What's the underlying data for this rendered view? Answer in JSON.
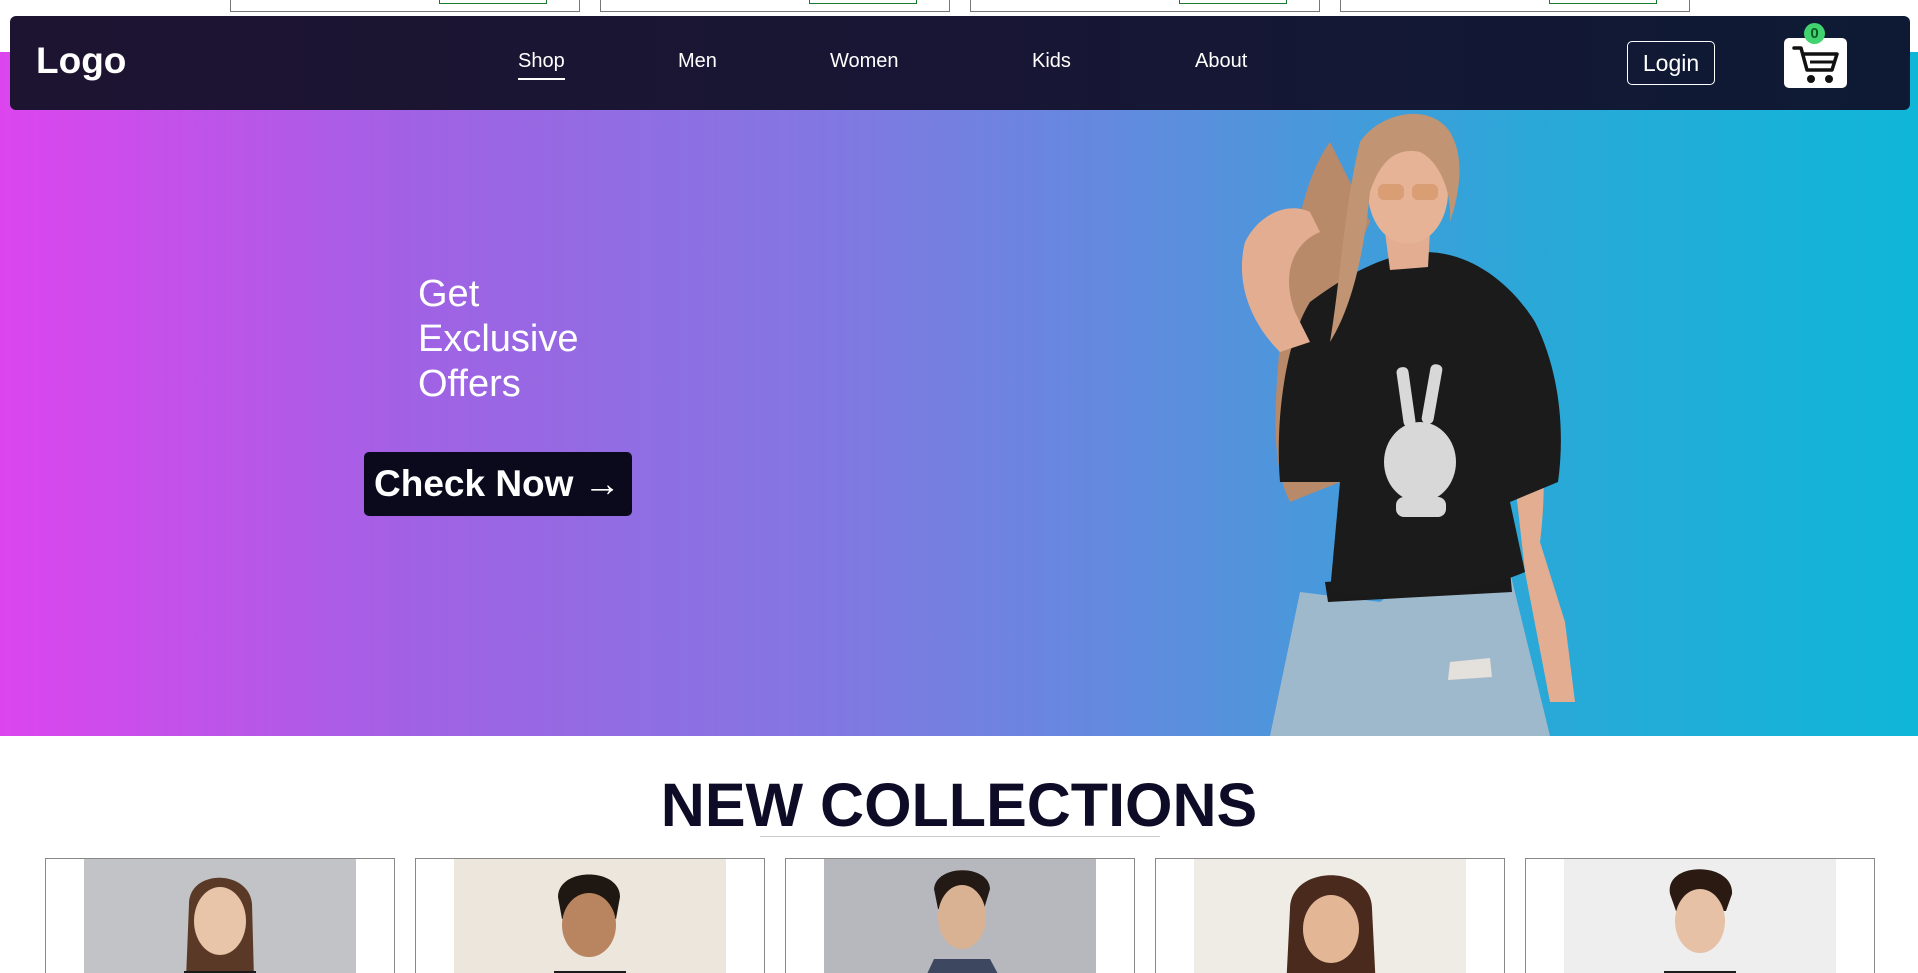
{
  "navbar": {
    "logo": "Logo",
    "links": [
      "Shop",
      "Men",
      "Women",
      "Kids",
      "About"
    ],
    "active_link": "Shop",
    "login_label": "Login",
    "cart_count": "0",
    "cart_icon": "shopping-cart-icon"
  },
  "hero": {
    "headline_lines": [
      "Get",
      "Exclusive",
      "Offers"
    ],
    "cta_label": "Check Now →",
    "image": "woman-in-black-tshirt-peace-sign"
  },
  "collections": {
    "title": "NEW COLLECTIONS",
    "cards": [
      {
        "image": "woman-model-photo"
      },
      {
        "image": "boy-model-photo"
      },
      {
        "image": "man-model-photo"
      },
      {
        "image": "woman-model-photo-2"
      },
      {
        "image": "man-model-photo-2"
      }
    ]
  },
  "colors": {
    "hero_gradient_start": "#dc45ee",
    "hero_gradient_end": "#0fb6d8",
    "navbar": "#181634",
    "cart_badge": "#40d36f",
    "cta_bg": "#0b0a1c"
  }
}
